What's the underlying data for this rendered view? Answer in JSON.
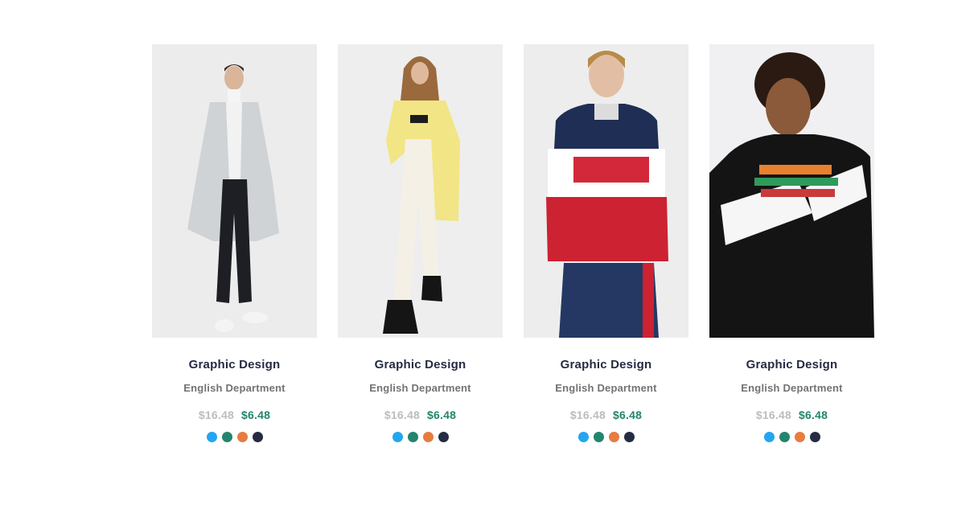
{
  "products": [
    {
      "image": "model-grey-parka",
      "title": "Graphic Design",
      "department": "English Department",
      "old_price": "$16.48",
      "new_price": "$6.48",
      "colors": [
        "#23a6f0",
        "#23856d",
        "#e77c40",
        "#252b42"
      ]
    },
    {
      "image": "model-yellow-cardigan",
      "title": "Graphic Design",
      "department": "English Department",
      "old_price": "$16.48",
      "new_price": "$6.48",
      "colors": [
        "#23a6f0",
        "#23856d",
        "#e77c40",
        "#252b42"
      ]
    },
    {
      "image": "model-striped-hoodie",
      "title": "Graphic Design",
      "department": "English Department",
      "old_price": "$16.48",
      "new_price": "$6.48",
      "colors": [
        "#23a6f0",
        "#23856d",
        "#e77c40",
        "#252b42"
      ]
    },
    {
      "image": "model-black-tshirt",
      "title": "Graphic Design",
      "department": "English Department",
      "old_price": "$16.48",
      "new_price": "$6.48",
      "colors": [
        "#23a6f0",
        "#23856d",
        "#e77c40",
        "#252b42"
      ]
    }
  ]
}
